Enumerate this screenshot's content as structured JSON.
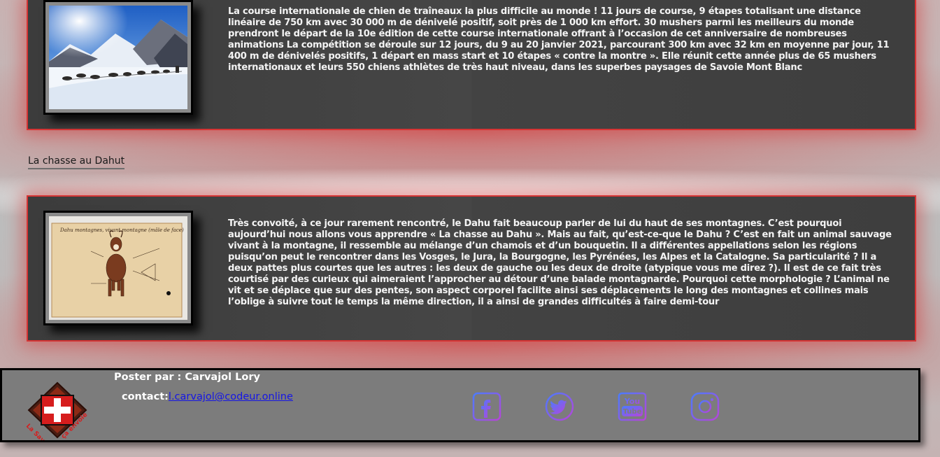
{
  "articles": [
    {
      "text": "La course internationale de chien de traîneaux la plus difficile au monde ! 11 jours de course, 9 étapes totalisant une distance linéaire de 750 km avec 30 000 m de dénivelé positif, soit près de 1 000 km effort. 30 mushers parmi les meilleurs du monde prendront le départ de la 10e édition de cette course internationale offrant à l’occasion de cet anniversaire de nombreuses animations La compétition se déroule sur 12 jours, du 9 au 20 janvier 2021, parcourant 300 km avec 32 km en moyenne par jour, 11 400 m de dénivelés positifs, 1 départ en mass start et 10 étapes « contre la montre ». Elle réunit cette année plus de 65 mushers internationaux et leurs 550 chiens athlètes de très haut niveau, dans les superbes paysages de Savoie Mont Blanc"
    },
    {
      "link_label": "La chasse au Dahut",
      "text": "Très convoité, à ce jour rarement rencontré, le Dahu fait beaucoup parler de lui du haut de ses montagnes. C’est pourquoi aujourd’hui nous allons vous apprendre « La chasse au Dahu ». Mais au fait, qu’est-ce-que le Dahu ? C’est en fait un animal sauvage vivant à la montagne, il ressemble au mélange d’un chamois et d’un bouquetin. Il a différentes appellations selon les régions puisqu’on peut le rencontrer dans les Vosges, le Jura, la Bourgogne, les Pyrénées, les Alpes et la Catalogne. Sa particularité ? Il a deux pattes plus courtes que les autres : les deux de gauche ou les deux de droite (atypique vous me direz ?). Il est de ce fait très courtisé par des curieux qui aimeraient l’approcher au détour d’une balade montagnarde. Pourquoi cette morphologie ? L’animal ne vit et se déplace que sur des pentes, son aspect corporel facilite ainsi ses déplacements le long des montagnes et collines mais l’oblige à suivre tout le temps la même direction, il a ainsi de grandes difficultés à faire demi-tour",
      "drawing_caption": "Dahu montagnes, vivant montagne (mâle de face)"
    }
  ],
  "footer": {
    "poster": "Poster par : Carvajol Lory",
    "contact_label": "contact:",
    "contact_email": "l.carvajol@codeur.online",
    "logo_text_left": "La Savoie",
    "logo_text_right": "ça envoie",
    "social_icons": [
      "facebook-icon",
      "twitter-icon",
      "youtube-icon",
      "instagram-icon"
    ],
    "youtube_text_top": "You",
    "youtube_text_bottom": "Tube"
  },
  "colors": {
    "article_border": "#d63434",
    "footer_bg": "#7c7c7c",
    "link": "#1515e6",
    "social_gradient_start": "#4a7bff",
    "social_gradient_end": "#b844d9"
  }
}
